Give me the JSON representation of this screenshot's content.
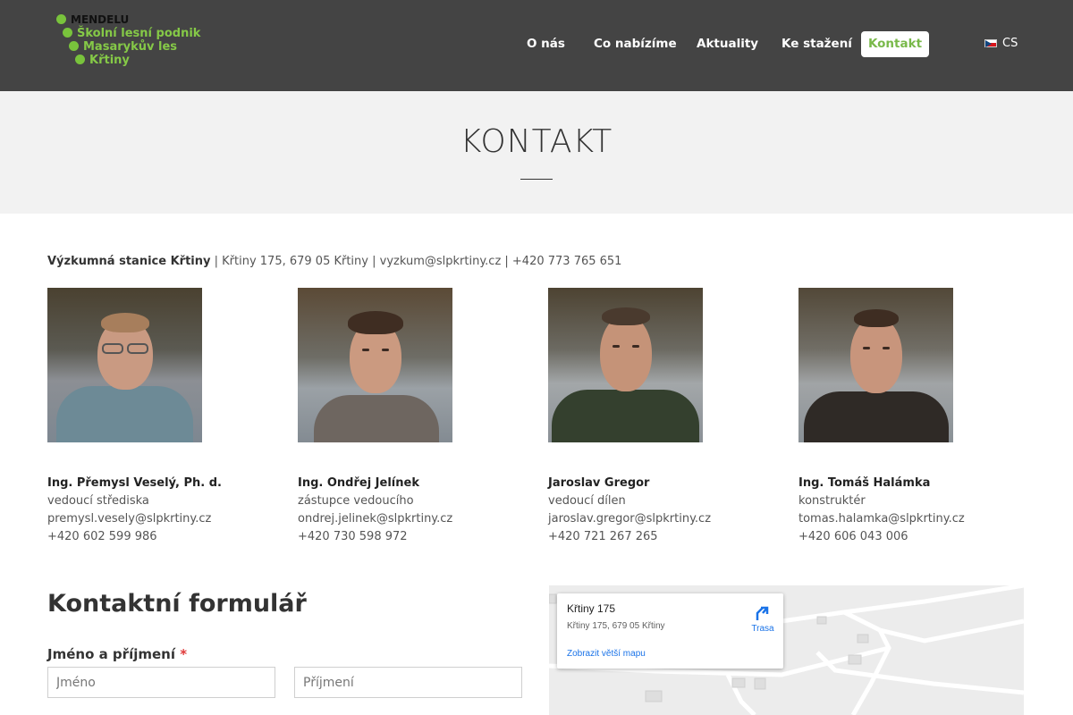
{
  "header": {
    "logo": {
      "line1": "MENDELU",
      "line2": "Školní lesní podnik",
      "line3": "Masarykův les",
      "line4": "Křtiny"
    },
    "nav": [
      {
        "label": "O nás"
      },
      {
        "label": "Co nabízíme"
      },
      {
        "label": "Aktuality"
      },
      {
        "label": "Ke stažení"
      },
      {
        "label": "Kontakt",
        "active": true
      }
    ],
    "language": "CS"
  },
  "page": {
    "title": "KONTAKT"
  },
  "station": {
    "name": "Výzkumná stanice Křtiny",
    "details": " | Křtiny 175, 679 05 Křtiny | vyzkum@slpkrtiny.cz | +420 773 765 651"
  },
  "people": [
    {
      "name": "Ing. Přemysl Veselý, Ph. d.",
      "role": "vedoucí střediska",
      "email": "premysl.vesely@slpkrtiny.cz",
      "phone": "+420 602 599 986"
    },
    {
      "name": "Ing. Ondřej Jelínek",
      "role": "zástupce vedoucího",
      "email": "ondrej.jelinek@slpkrtiny.cz",
      "phone": "+420 730 598 972"
    },
    {
      "name": "Jaroslav Gregor",
      "role": "vedoucí dílen",
      "email": "jaroslav.gregor@slpkrtiny.cz",
      "phone": "+420 721 267 265"
    },
    {
      "name": "Ing. Tomáš Halámka",
      "role": "konstruktér",
      "email": "tomas.halamka@slpkrtiny.cz",
      "phone": "+420 606 043 006"
    }
  ],
  "form": {
    "title": "Kontaktní formulář",
    "name_label": "Jméno a příjmení",
    "required_mark": "*",
    "first_name_placeholder": "Jméno",
    "last_name_placeholder": "Příjmení"
  },
  "map": {
    "address": "Křtiny 175",
    "subaddress": "Křtiny 175, 679 05 Křtiny",
    "route_label": "Trasa",
    "larger_map_link": "Zobrazit větší mapu"
  },
  "colors": {
    "header_bg": "#444444",
    "accent_green": "#79b94a",
    "title_band_bg": "#f2f2f2"
  }
}
